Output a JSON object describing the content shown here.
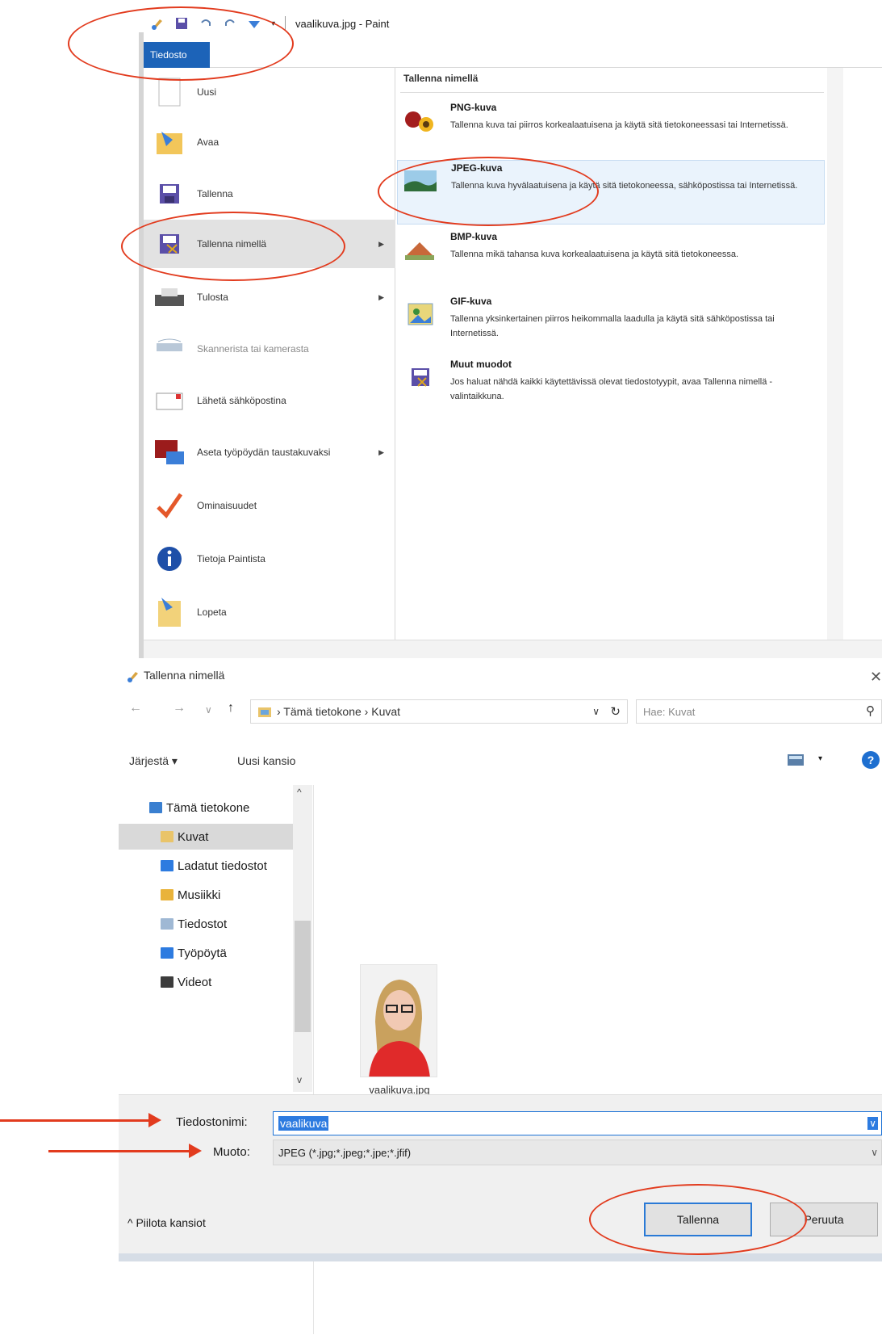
{
  "paint": {
    "window_title": "vaalikuva.jpg - Paint",
    "file_tab": "Tiedosto",
    "menu_items": [
      {
        "label": "Uusi",
        "icon": "new-document-icon",
        "submenu": false
      },
      {
        "label": "Avaa",
        "icon": "open-folder-icon",
        "submenu": false
      },
      {
        "label": "Tallenna",
        "icon": "floppy-disk-icon",
        "submenu": false
      },
      {
        "label": "Tallenna nimellä",
        "icon": "save-as-icon",
        "submenu": true
      },
      {
        "label": "Tulosta",
        "icon": "printer-icon",
        "submenu": true
      },
      {
        "label": "Skannerista tai kamerasta",
        "icon": "scanner-icon",
        "submenu": false
      },
      {
        "label": "Lähetä sähköpostina",
        "icon": "email-icon",
        "submenu": false
      },
      {
        "label": "Aseta työpöydän taustakuvaksi",
        "icon": "desktop-background-icon",
        "submenu": true
      },
      {
        "label": "Ominaisuudet",
        "icon": "checkmark-icon",
        "submenu": false
      },
      {
        "label": "Tietoja Paintista",
        "icon": "info-icon",
        "submenu": false
      },
      {
        "label": "Lopeta",
        "icon": "exit-icon",
        "submenu": false
      }
    ],
    "save_as_panel": {
      "title": "Tallenna nimellä",
      "formats": [
        {
          "name": "PNG-kuva",
          "desc": "Tallenna kuva tai piirros korkealaatuisena ja käytä sitä tietokoneessasi tai Internetissä.",
          "icon": "png-image-icon"
        },
        {
          "name": "JPEG-kuva",
          "desc": "Tallenna kuva hyvälaatuisena ja käytä sitä tietokoneessa, sähköpostissa tai Internetissä.",
          "icon": "jpeg-image-icon"
        },
        {
          "name": "BMP-kuva",
          "desc": "Tallenna mikä tahansa kuva korkealaatuisena ja käytä sitä tietokoneessa.",
          "icon": "bmp-image-icon"
        },
        {
          "name": "GIF-kuva",
          "desc": "Tallenna yksinkertainen piirros heikommalla laadulla ja käytä sitä sähköpostissa tai Internetissä.",
          "icon": "gif-image-icon"
        },
        {
          "name": "Muut muodot",
          "desc": "Jos haluat nähdä kaikki käytettävissä olevat tiedostotyypit, avaa Tallenna nimellä -valintaikkuna.",
          "icon": "other-formats-icon"
        }
      ]
    }
  },
  "dialog": {
    "title": "Tallenna nimellä",
    "close_glyph": "✕",
    "breadcrumb": "› Tämä tietokone › Kuvat",
    "search_placeholder": "Hae: Kuvat",
    "organize": "Järjestä ▾",
    "new_folder": "Uusi kansio",
    "help_glyph": "?",
    "tree": [
      {
        "label": "Tämä tietokone",
        "color": "#3a7fd0"
      },
      {
        "label": "Kuvat",
        "color": "#e9c46a"
      },
      {
        "label": "Ladatut tiedostot",
        "color": "#2d7be0"
      },
      {
        "label": "Musiikki",
        "color": "#e9b33a"
      },
      {
        "label": "Tiedostot",
        "color": "#9fb8d4"
      },
      {
        "label": "Työpöytä",
        "color": "#2d7be0"
      },
      {
        "label": "Videot",
        "color": "#3c3c3c"
      }
    ],
    "file_thumbnail_caption": "vaalikuva.jpg",
    "filename_label": "Tiedostonimi:",
    "filename_value": "vaalikuva",
    "format_label": "Muoto:",
    "format_value": "JPEG (*.jpg;*.jpeg;*.jpe;*.jfif)",
    "hide_folders": "^ Piilota kansiot",
    "save_button": "Tallenna",
    "cancel_button": "Peruuta"
  },
  "colors": {
    "accent": "#1c63b8",
    "annotation": "#e23b1e",
    "highlight": "#eaf3fc"
  }
}
